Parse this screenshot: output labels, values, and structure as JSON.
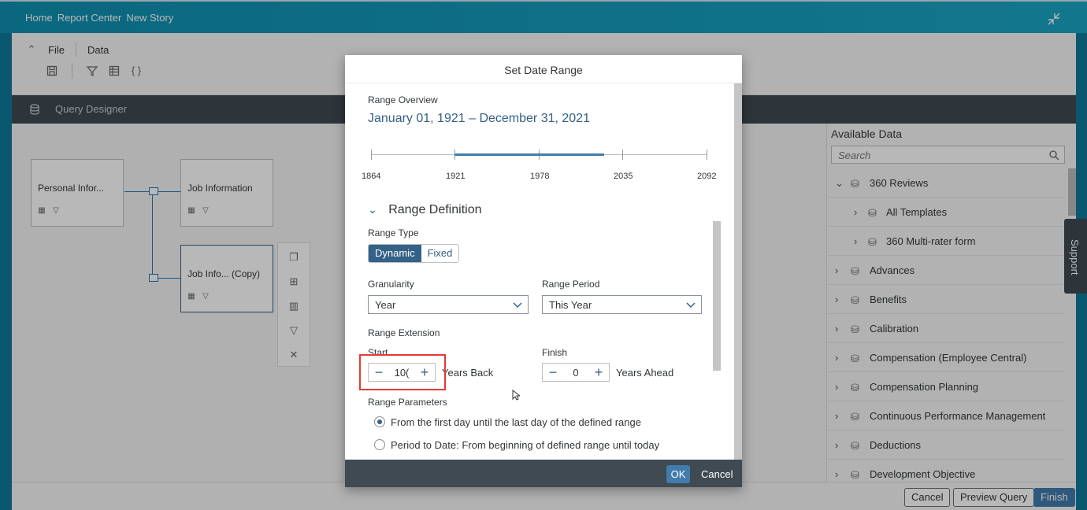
{
  "shell": {
    "crumbs": [
      "Home",
      "Report Center",
      "New Story"
    ]
  },
  "toolbar": {
    "file_label": "File",
    "data_label": "Data"
  },
  "query_designer": {
    "label": "Query Designer"
  },
  "canvas": {
    "nodes": [
      {
        "label": "Personal Infor..."
      },
      {
        "label": "Job Information"
      },
      {
        "label": "Job Info... (Copy)"
      }
    ]
  },
  "available_data": {
    "title": "Available Data",
    "search_placeholder": "Search",
    "items": [
      {
        "label": "360 Reviews",
        "expanded": true
      },
      {
        "label": "All Templates",
        "sub": true
      },
      {
        "label": "360 Multi-rater form",
        "sub": true
      },
      {
        "label": "Advances"
      },
      {
        "label": "Benefits"
      },
      {
        "label": "Calibration"
      },
      {
        "label": "Compensation (Employee Central)"
      },
      {
        "label": "Compensation Planning"
      },
      {
        "label": "Continuous Performance Management"
      },
      {
        "label": "Deductions"
      },
      {
        "label": "Development Objective"
      }
    ]
  },
  "support": {
    "label": "Support"
  },
  "footer": {
    "cancel_label": "Cancel",
    "preview_label": "Preview Query",
    "finish_label": "Finish"
  },
  "dialog": {
    "title": "Set Date Range",
    "overview_label": "Range Overview",
    "range_text": "January 01, 1921 – December 31, 2021",
    "ticks": [
      "1864",
      "1921",
      "1978",
      "2035",
      "2092"
    ],
    "section_title": "Range Definition",
    "range_type_label": "Range Type",
    "range_type_options": [
      "Dynamic",
      "Fixed"
    ],
    "range_type_selected": "Dynamic",
    "granularity_label": "Granularity",
    "granularity_value": "Year",
    "period_label": "Range Period",
    "period_value": "This Year",
    "extension_label": "Range Extension",
    "start_label": "Start",
    "start_value": "10(",
    "start_suffix": "Years Back",
    "finish_label": "Finish",
    "finish_value": "0",
    "finish_suffix": "Years Ahead",
    "params_label": "Range Parameters",
    "param_option_1": "From the first day until the last day of the defined range",
    "param_option_2": "Period to Date: From beginning of defined range until today",
    "ok_label": "OK",
    "cancel_label": "Cancel"
  }
}
